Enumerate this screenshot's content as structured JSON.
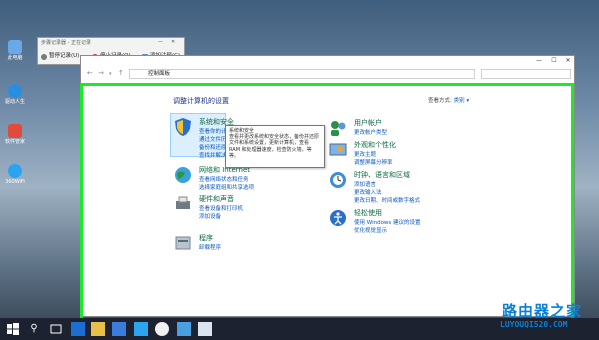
{
  "desktop": {
    "icons": [
      {
        "label": "此电脑",
        "color": "#6aa9e8"
      },
      {
        "label": "回收站",
        "color": "#d0dbe6"
      },
      {
        "label": "驱动人生",
        "color": "#2a8ee0"
      },
      {
        "label": "软件管家",
        "color": "#e24a3b"
      },
      {
        "label": "360WiFi",
        "color": "#2aa3f0"
      }
    ]
  },
  "recorder": {
    "title": "步骤记录器 - 正在记录",
    "pause_label": "暂停记录(U)",
    "stop_label": "停止记录(O)",
    "comment_label": "添加注释(C)"
  },
  "window": {
    "breadcrumb": "控制面板",
    "heading": "调整计算机的设置",
    "view_by_label": "查看方式:",
    "view_by_value": "类别 ▾"
  },
  "categories_left": [
    {
      "title": "系统和安全",
      "links": [
        "查看你的计算机状态",
        "通过文件历史记录保存你的文件备份副本",
        "备份和还原(Windows 7)",
        "查找并解决问题"
      ],
      "icon_color": "#2a6fc9"
    },
    {
      "title": "网络和 Internet",
      "links": [
        "查看网络状态和任务",
        "选择家庭组和共享选项"
      ],
      "icon_color": "#2c9a3c"
    },
    {
      "title": "硬件和声音",
      "links": [
        "查看设备和打印机",
        "添加设备"
      ],
      "icon_color": "#6e7a86"
    },
    {
      "title": "程序",
      "links": [
        "卸载程序"
      ],
      "icon_color": "#8a9aa8"
    }
  ],
  "categories_right": [
    {
      "title": "用户帐户",
      "links": [
        "更改帐户类型"
      ],
      "icon_color": "#2f8f4a"
    },
    {
      "title": "外观和个性化",
      "links": [
        "更改主题",
        "调整屏幕分辨率"
      ],
      "icon_color": "#c8742a"
    },
    {
      "title": "时钟、语言和区域",
      "links": [
        "添加语言",
        "更改输入法",
        "更改日期、时间或数字格式"
      ],
      "icon_color": "#2a7fc9"
    },
    {
      "title": "轻松使用",
      "links": [
        "使用 Windows 建议的设置",
        "优化视觉显示"
      ],
      "icon_color": "#2a6fc9"
    }
  ],
  "tooltip": {
    "title": "系统和安全",
    "text": "查看并更改系统和安全状态，备份并还原文件和系统设置，更新计算机，查看 RAM 和处理器速度，检查防火墙，等等。"
  },
  "watermark": {
    "line1": "路由器之家",
    "line2": "LUYOUQI520.COM"
  }
}
